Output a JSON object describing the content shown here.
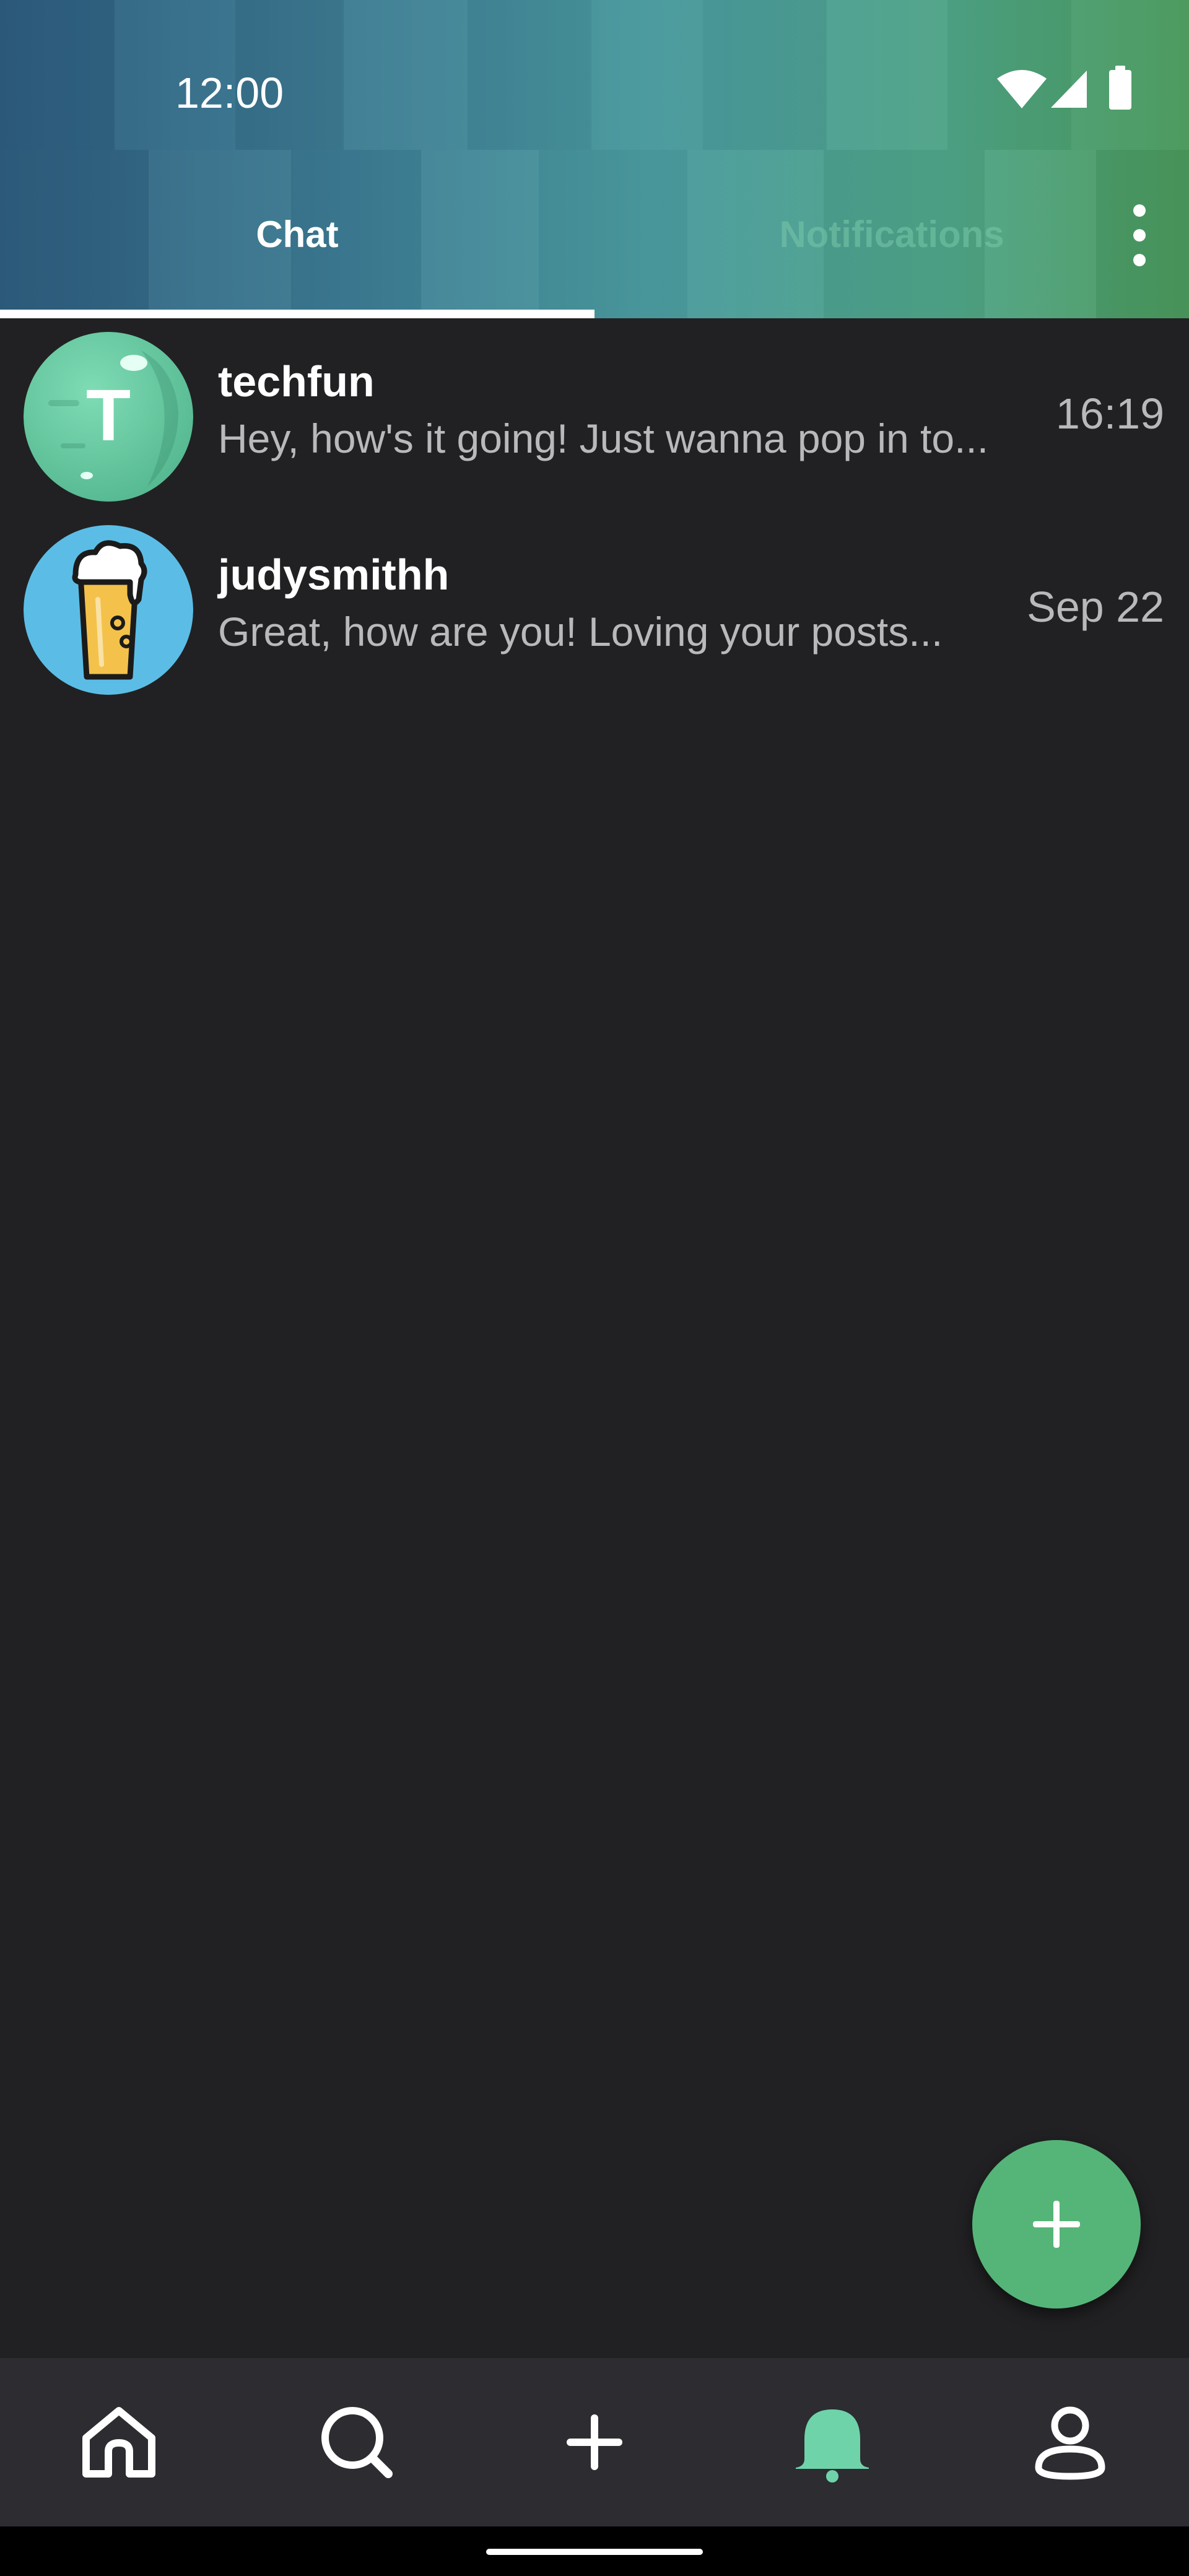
{
  "status_bar": {
    "time": "12:00",
    "icons": [
      "wifi-icon",
      "signal-icon",
      "battery-icon"
    ]
  },
  "tabs": [
    {
      "label": "Chat",
      "selected": true
    },
    {
      "label": "Notifications",
      "selected": false
    }
  ],
  "menu_icon": "more-vert-icon",
  "chats": [
    {
      "name": "techfun",
      "preview": "Hey, how's it going! Just wanna pop in to...",
      "time": "16:19",
      "avatar": {
        "type": "letter",
        "letter": "T",
        "color": "#6fd3aa"
      }
    },
    {
      "name": "judysmithh",
      "preview": "Great, how are you! Loving your posts...",
      "time": "Sep 22",
      "avatar": {
        "type": "beer-icon",
        "color": "#5bbde6"
      }
    }
  ],
  "fab": {
    "icon": "plus-icon",
    "color": "#55b578"
  },
  "bottom_nav": [
    {
      "icon": "home-icon",
      "active": false
    },
    {
      "icon": "search-icon",
      "active": false
    },
    {
      "icon": "plus-icon",
      "active": false
    },
    {
      "icon": "bell-icon",
      "active": true
    },
    {
      "icon": "profile-icon",
      "active": false
    }
  ],
  "colors": {
    "background": "#212123",
    "accent": "#55b578",
    "active_nav": "#6fd3aa",
    "nav_background": "#2c2c31",
    "secondary_text": "#b9b9bc"
  }
}
